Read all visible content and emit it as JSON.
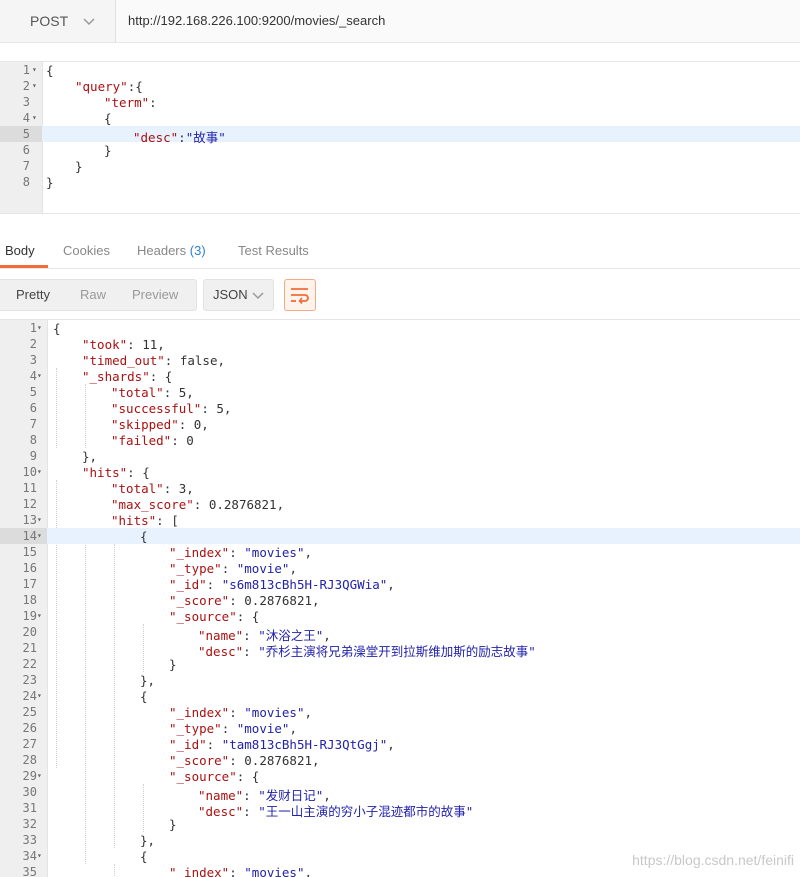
{
  "request": {
    "method": "POST",
    "url": "http://192.168.226.100:9200/movies/_search",
    "body_lines": [
      {
        "n": "1",
        "fold": true,
        "indent": 0,
        "text": "{"
      },
      {
        "n": "2",
        "fold": true,
        "indent": 1,
        "key": "\"query\"",
        "rest": ":{"
      },
      {
        "n": "3",
        "fold": false,
        "indent": 2,
        "key": "\"term\"",
        "rest": ":"
      },
      {
        "n": "4",
        "fold": true,
        "indent": 2,
        "text": "{"
      },
      {
        "n": "5",
        "fold": false,
        "indent": 3,
        "key": "\"desc\"",
        "rest": ":",
        "str": "\"故事\"",
        "highlight": true
      },
      {
        "n": "6",
        "fold": false,
        "indent": 2,
        "text": "}"
      },
      {
        "n": "7",
        "fold": false,
        "indent": 1,
        "text": "}"
      },
      {
        "n": "8",
        "fold": false,
        "indent": 0,
        "text": "}"
      }
    ]
  },
  "response_tabs": {
    "body": "Body",
    "cookies": "Cookies",
    "headers": "Headers",
    "headers_count": "(3)",
    "test_results": "Test Results"
  },
  "format": {
    "pretty": "Pretty",
    "raw": "Raw",
    "preview": "Preview",
    "type": "JSON"
  },
  "response_lines": [
    {
      "n": "1",
      "fold": true,
      "indent": 0,
      "text": "{"
    },
    {
      "n": "2",
      "indent": 1,
      "key": "\"took\"",
      "rest": ": 11,"
    },
    {
      "n": "3",
      "indent": 1,
      "key": "\"timed_out\"",
      "rest": ": false,"
    },
    {
      "n": "4",
      "fold": true,
      "indent": 1,
      "key": "\"_shards\"",
      "rest": ": {"
    },
    {
      "n": "5",
      "indent": 2,
      "key": "\"total\"",
      "rest": ": 5,"
    },
    {
      "n": "6",
      "indent": 2,
      "key": "\"successful\"",
      "rest": ": 5,"
    },
    {
      "n": "7",
      "indent": 2,
      "key": "\"skipped\"",
      "rest": ": 0,"
    },
    {
      "n": "8",
      "indent": 2,
      "key": "\"failed\"",
      "rest": ": 0"
    },
    {
      "n": "9",
      "indent": 1,
      "text": "},"
    },
    {
      "n": "10",
      "fold": true,
      "indent": 1,
      "key": "\"hits\"",
      "rest": ": {"
    },
    {
      "n": "11",
      "indent": 2,
      "key": "\"total\"",
      "rest": ": 3,"
    },
    {
      "n": "12",
      "indent": 2,
      "key": "\"max_score\"",
      "rest": ": 0.2876821,"
    },
    {
      "n": "13",
      "fold": true,
      "indent": 2,
      "key": "\"hits\"",
      "rest": ": ["
    },
    {
      "n": "14",
      "fold": true,
      "indent": 3,
      "text": "{",
      "highlight": true
    },
    {
      "n": "15",
      "indent": 4,
      "key": "\"_index\"",
      "rest": ": ",
      "str": "\"movies\"",
      "tail": ","
    },
    {
      "n": "16",
      "indent": 4,
      "key": "\"_type\"",
      "rest": ": ",
      "str": "\"movie\"",
      "tail": ","
    },
    {
      "n": "17",
      "indent": 4,
      "key": "\"_id\"",
      "rest": ": ",
      "str": "\"s6m813cBh5H-RJ3QGWia\"",
      "tail": ","
    },
    {
      "n": "18",
      "indent": 4,
      "key": "\"_score\"",
      "rest": ": 0.2876821,"
    },
    {
      "n": "19",
      "fold": true,
      "indent": 4,
      "key": "\"_source\"",
      "rest": ": {"
    },
    {
      "n": "20",
      "indent": 5,
      "key": "\"name\"",
      "rest": ": ",
      "str": "\"沐浴之王\"",
      "tail": ","
    },
    {
      "n": "21",
      "indent": 5,
      "key": "\"desc\"",
      "rest": ": ",
      "str": "\"乔杉主演将兄弟澡堂开到拉斯维加斯的励志故事\""
    },
    {
      "n": "22",
      "indent": 4,
      "text": "}"
    },
    {
      "n": "23",
      "indent": 3,
      "text": "},"
    },
    {
      "n": "24",
      "fold": true,
      "indent": 3,
      "text": "{"
    },
    {
      "n": "25",
      "indent": 4,
      "key": "\"_index\"",
      "rest": ": ",
      "str": "\"movies\"",
      "tail": ","
    },
    {
      "n": "26",
      "indent": 4,
      "key": "\"_type\"",
      "rest": ": ",
      "str": "\"movie\"",
      "tail": ","
    },
    {
      "n": "27",
      "indent": 4,
      "key": "\"_id\"",
      "rest": ": ",
      "str": "\"tam813cBh5H-RJ3QtGgj\"",
      "tail": ","
    },
    {
      "n": "28",
      "indent": 4,
      "key": "\"_score\"",
      "rest": ": 0.2876821,"
    },
    {
      "n": "29",
      "fold": true,
      "indent": 4,
      "key": "\"_source\"",
      "rest": ": {"
    },
    {
      "n": "30",
      "indent": 5,
      "key": "\"name\"",
      "rest": ": ",
      "str": "\"发财日记\"",
      "tail": ","
    },
    {
      "n": "31",
      "indent": 5,
      "key": "\"desc\"",
      "rest": ": ",
      "str": "\"王一山主演的穷小子混迹都市的故事\""
    },
    {
      "n": "32",
      "indent": 4,
      "text": "}"
    },
    {
      "n": "33",
      "indent": 3,
      "text": "},"
    },
    {
      "n": "34",
      "fold": true,
      "indent": 3,
      "text": "{"
    },
    {
      "n": "35",
      "indent": 4,
      "key": "\"_index\"",
      "rest": ": ",
      "str": "\"movies\"",
      "tail": ","
    }
  ],
  "watermark": "https://blog.csdn.net/feinifi"
}
